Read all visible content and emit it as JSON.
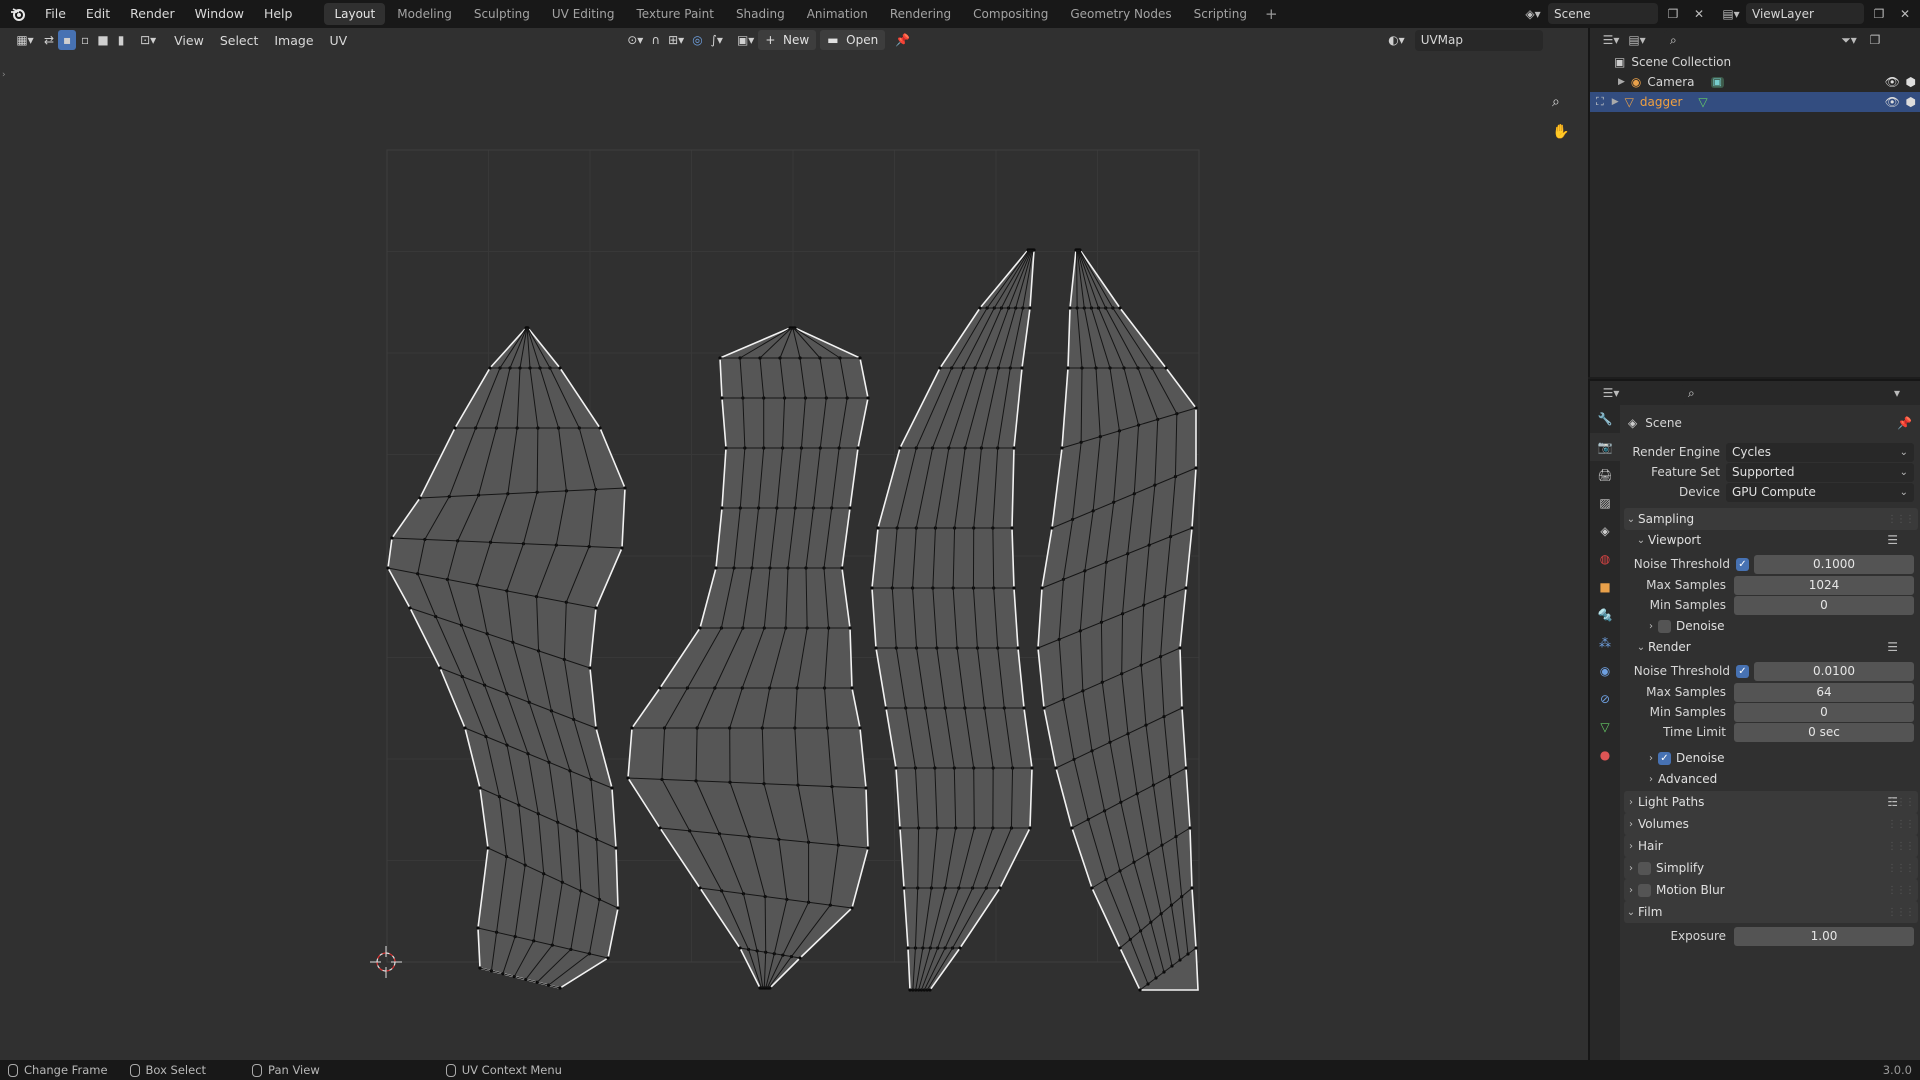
{
  "menu": [
    "File",
    "Edit",
    "Render",
    "Window",
    "Help"
  ],
  "workspaces": [
    "Layout",
    "Modeling",
    "Sculpting",
    "UV Editing",
    "Texture Paint",
    "Shading",
    "Animation",
    "Rendering",
    "Compositing",
    "Geometry Nodes",
    "Scripting"
  ],
  "active_workspace": "Layout",
  "scene_name": "Scene",
  "view_layer": "ViewLayer",
  "uv_header": {
    "menus": [
      "View",
      "Select",
      "Image",
      "UV"
    ],
    "new_label": "New",
    "open_label": "Open",
    "uvmap": "UVMap"
  },
  "outliner": {
    "root": "Scene Collection",
    "items": [
      {
        "label": "Camera",
        "selected": false
      },
      {
        "label": "dagger",
        "selected": true
      }
    ]
  },
  "properties": {
    "title": "Scene",
    "render_engine_label": "Render Engine",
    "render_engine": "Cycles",
    "feature_set_label": "Feature Set",
    "feature_set": "Supported",
    "device_label": "Device",
    "device": "GPU Compute",
    "sampling": "Sampling",
    "viewport": "Viewport",
    "noise_threshold_label": "Noise Threshold",
    "max_samples_label": "Max Samples",
    "min_samples_label": "Min Samples",
    "time_limit_label": "Time Limit",
    "viewport_noise": "0.1000",
    "viewport_max": "1024",
    "viewport_min": "0",
    "denoise": "Denoise",
    "render": "Render",
    "render_noise": "0.0100",
    "render_max": "64",
    "render_min": "0",
    "render_time": "0 sec",
    "advanced": "Advanced",
    "light_paths": "Light Paths",
    "volumes": "Volumes",
    "hair": "Hair",
    "simplify": "Simplify",
    "motion_blur": "Motion Blur",
    "film": "Film",
    "exposure_label": "Exposure",
    "exposure": "1.00"
  },
  "status": {
    "change_frame": "Change Frame",
    "box_select": "Box Select",
    "pan_view": "Pan View",
    "uv_context": "UV Context Menu",
    "version": "3.0.0"
  },
  "colors": {
    "accent": "#4772b3",
    "selected_row": "#334d80",
    "island_fill": "#565656"
  }
}
